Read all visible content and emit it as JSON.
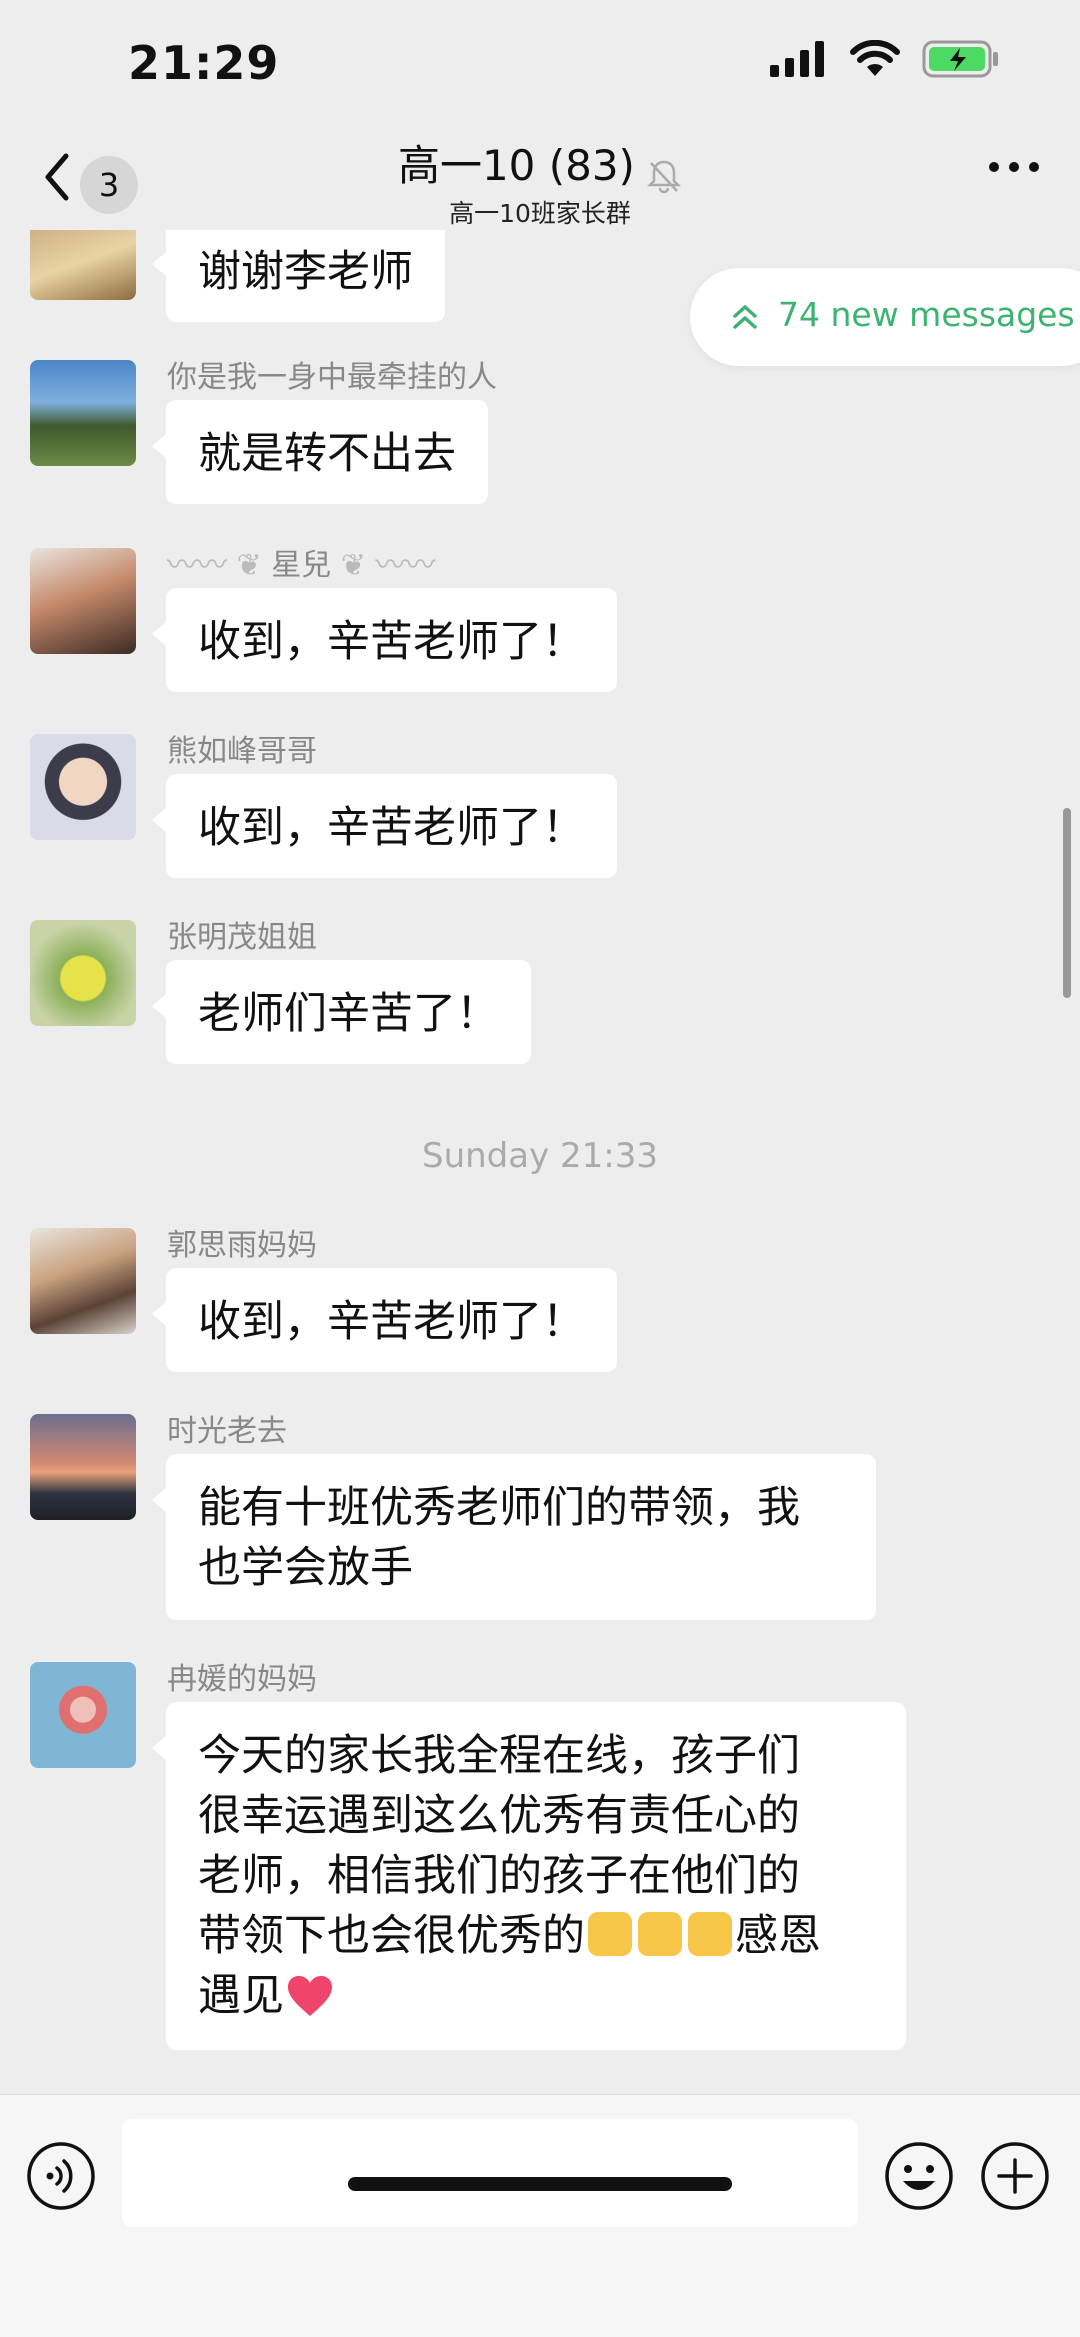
{
  "status_bar": {
    "time": "21:29"
  },
  "header": {
    "back_count": "3",
    "title": "高一10 (83)",
    "subtitle": "高一10班家长群"
  },
  "new_messages_pill": {
    "text": "74 new messages"
  },
  "messages": [
    {
      "sender": "",
      "text": "谢谢李老师"
    },
    {
      "sender": "你是我一身中最牵挂的人",
      "text": "就是转不出去"
    },
    {
      "sender": "星兒",
      "text": "收到，辛苦老师了！"
    },
    {
      "sender": "熊如峰哥哥",
      "text": "收到，辛苦老师了！"
    },
    {
      "sender": "张明茂姐姐",
      "text": "老师们辛苦了！"
    },
    {
      "sender": "郭思雨妈妈",
      "text": "收到，辛苦老师了！"
    },
    {
      "sender": "时光老去",
      "text_lines": [
        "能有十班优秀老师们的带领，我",
        "也学会放手"
      ]
    },
    {
      "sender": "冉媛的妈妈",
      "text_lines": [
        "今天的家长我全程在线，孩子们",
        "很幸运遇到这么优秀有责任心的",
        "老师，相信我们的孩子在他们的",
        "带领下也会很优秀的",
        "感恩",
        "遇见"
      ]
    }
  ],
  "timestamp": "Sunday 21:33",
  "colors": {
    "background": "#ededed",
    "bubble": "#ffffff",
    "accent_green": "#3cb371"
  },
  "icons": [
    "signal-icon",
    "wifi-icon",
    "battery-icon",
    "back-chevron-icon",
    "mute-bell-icon",
    "more-icon",
    "double-chevron-up-icon",
    "voice-icon",
    "emoji-icon",
    "plus-icon"
  ]
}
